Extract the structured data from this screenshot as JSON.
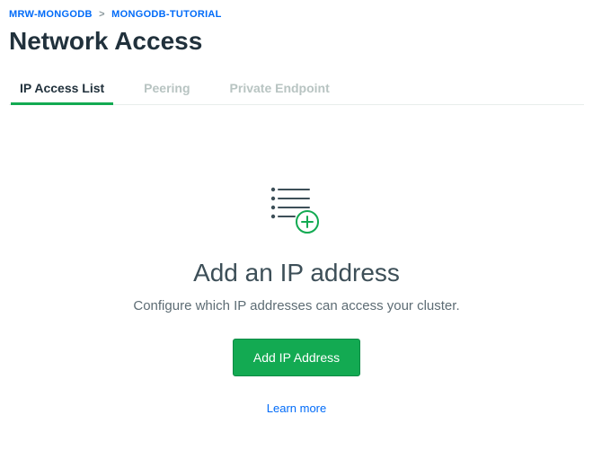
{
  "breadcrumb": {
    "project": "MRW-MONGODB",
    "item": "MONGODB-TUTORIAL"
  },
  "page_title": "Network Access",
  "tabs": {
    "access_list": "IP Access List",
    "peering": "Peering",
    "private_endpoint": "Private Endpoint"
  },
  "empty": {
    "title": "Add an IP address",
    "subtitle": "Configure which IP addresses can access your cluster.",
    "button": "Add IP Address",
    "learn_more": "Learn more"
  }
}
